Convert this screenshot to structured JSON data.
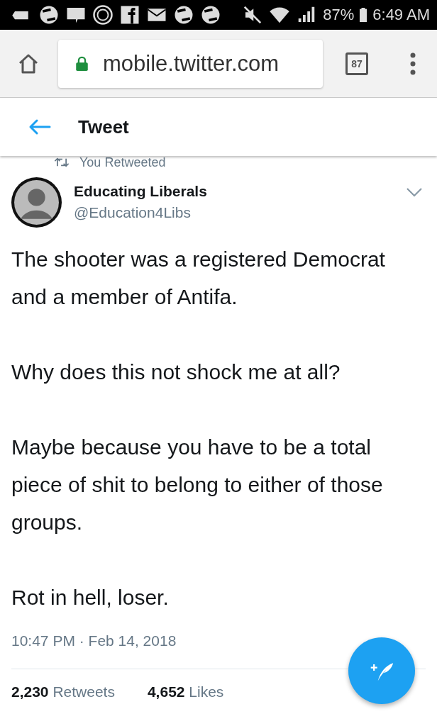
{
  "status_bar": {
    "battery": "87%",
    "time": "6:49 AM"
  },
  "browser": {
    "url": "mobile.twitter.com",
    "tab_count": "87"
  },
  "header": {
    "title": "Tweet"
  },
  "retweet_note": "You Retweeted",
  "tweet": {
    "author": "Educating Liberals",
    "handle": "@Education4Libs",
    "paragraphs": [
      "The shooter was a registered Democrat and a member of Antifa.",
      "Why does this not shock me at all?",
      "Maybe because you have to be a total piece of shit to belong to either of those groups.",
      "Rot in hell, loser."
    ],
    "timestamp": "10:47 PM · Feb 14, 2018",
    "stats": [
      "**2,230** Retweets",
      "**4,652** Likes"
    ]
  }
}
